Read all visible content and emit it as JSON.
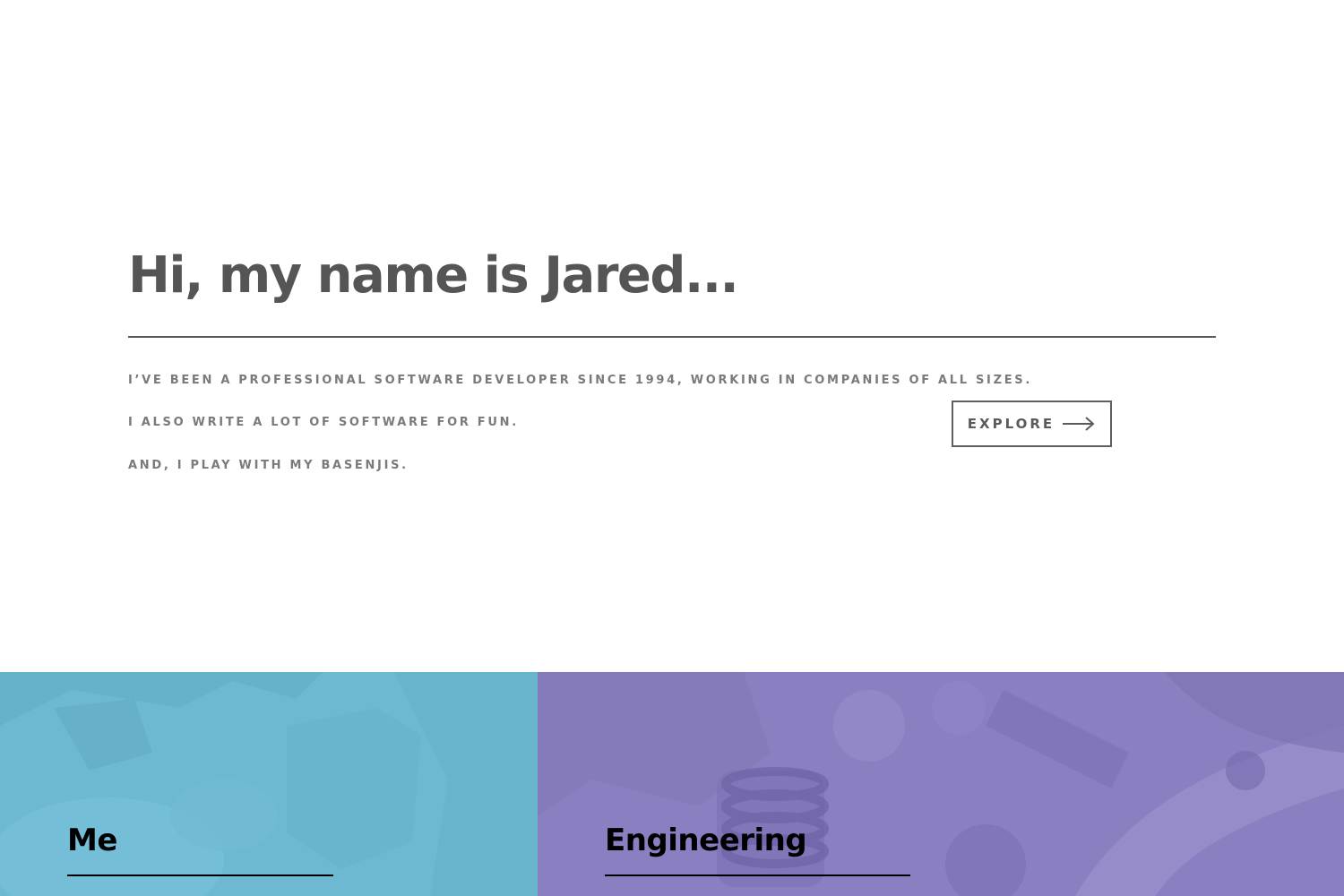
{
  "hero": {
    "title": "Hi, my name is Jared...",
    "lines": [
      "I’VE BEEN A PROFESSIONAL SOFTWARE DEVELOPER SINCE 1994, WORKING IN COMPANIES OF ALL SIZES.",
      "I ALSO WRITE A LOT OF SOFTWARE FOR FUN.",
      "AND, I PLAY WITH MY BASENJIS."
    ],
    "explore_label": "EXPLORE",
    "explore_icon": "arrow-right-icon"
  },
  "cards": [
    {
      "title": "Me",
      "color": "#6eb9d2",
      "image": "person-photo-blue-tint"
    },
    {
      "title": "Engineering",
      "color": "#8a7fc0",
      "image": "engine-machinery-photo-purple-tint"
    }
  ],
  "colors": {
    "text_dark": "#555555",
    "text_muted": "#7a7a7a",
    "background": "#ffffff"
  }
}
